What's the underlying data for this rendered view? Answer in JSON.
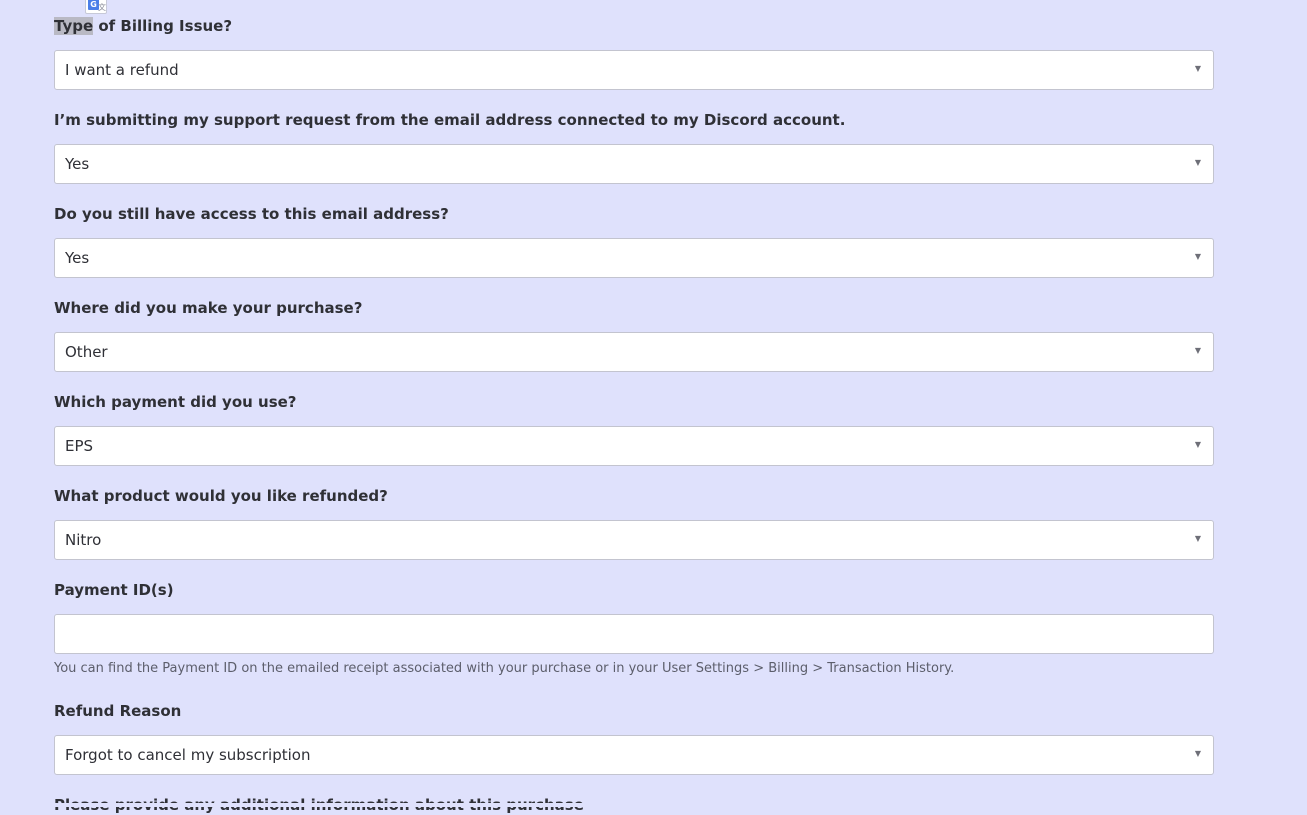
{
  "fields": [
    {
      "label_hl": "Type",
      "label_rest": " of Billing Issue?",
      "value": "I want a refund"
    },
    {
      "label": "I’m submitting my support request from the email address connected to my Discord account.",
      "value": "Yes"
    },
    {
      "label": "Do you still have access to this email address?",
      "value": "Yes"
    },
    {
      "label": "Where did you make your purchase?",
      "value": "Other"
    },
    {
      "label": "Which payment did you use?",
      "value": "EPS"
    },
    {
      "label": "What product would you like refunded?",
      "value": "Nitro"
    },
    {
      "label": "Payment ID(s)",
      "value": "",
      "hint": "You can find the Payment ID on the emailed receipt associated with your purchase or in your User Settings > Billing > Transaction History."
    },
    {
      "label": "Refund Reason",
      "value": "Forgot to cancel my subscription"
    }
  ],
  "next_label": "Please provide any additional information about this purchase",
  "icons": {
    "caret": "▼",
    "translate_g": "G",
    "translate_x": "文"
  }
}
